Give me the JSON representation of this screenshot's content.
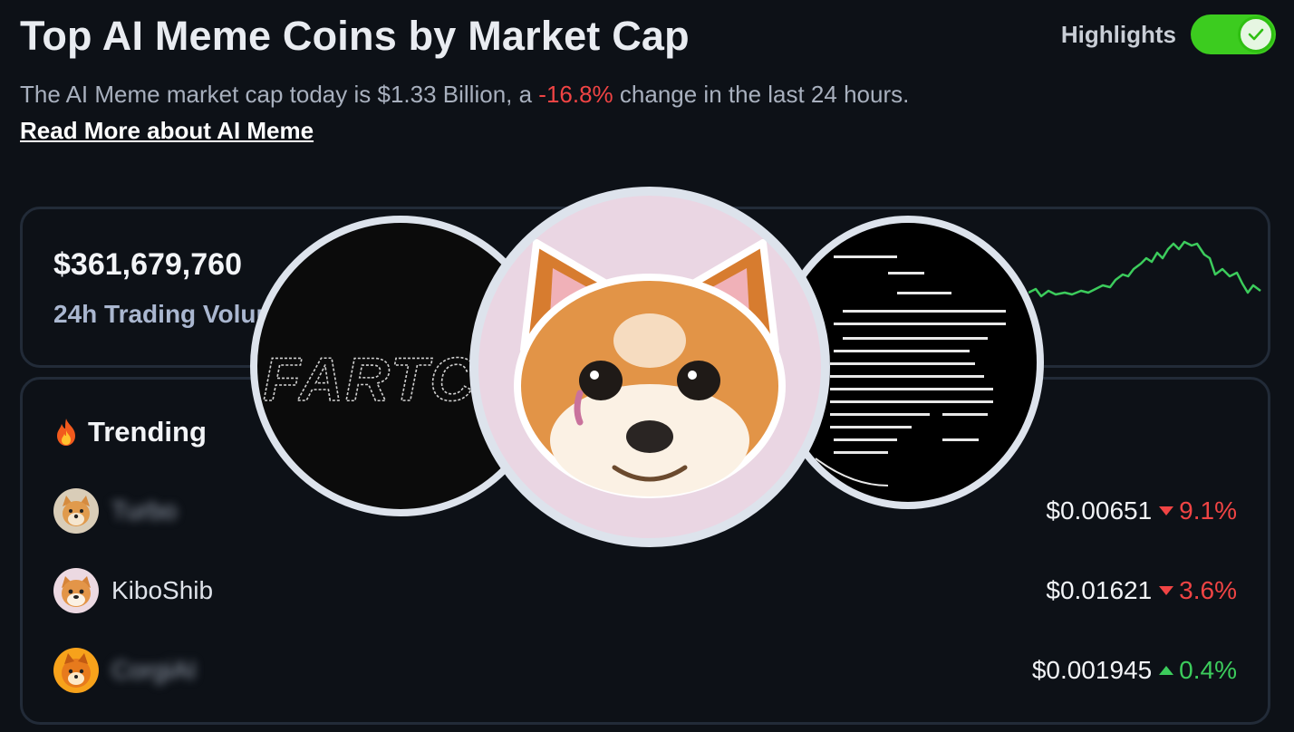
{
  "header": {
    "title": "Top AI Meme Coins by Market Cap",
    "subtitle_prefix": "The AI Meme market cap today is $1.33 Billion, a ",
    "subtitle_change": "-16.8%",
    "subtitle_suffix": " change in the last 24 hours. ",
    "read_more_link": "Read More about AI Meme",
    "highlights_label": "Highlights",
    "highlights_enabled": true
  },
  "volume_card": {
    "value": "$361,679,760",
    "label": "24h Trading Volume"
  },
  "overlay": {
    "left_logo_text": "FARTCOIN"
  },
  "trending": {
    "title": "Trending",
    "icon": "fire-icon",
    "items": [
      {
        "name": "Turbo",
        "name_blurred": true,
        "price": "$0.00651",
        "change": "9.1%",
        "direction": "down",
        "avatar_icon": "shiba-dog-icon"
      },
      {
        "name": "KiboShib",
        "name_blurred": false,
        "price": "$0.01621",
        "change": "3.6%",
        "direction": "down",
        "avatar_icon": "shiba-face-icon"
      },
      {
        "name": "CorgiAI",
        "name_blurred": true,
        "price": "$0.001945",
        "change": "0.4%",
        "direction": "up",
        "avatar_icon": "corgi-icon"
      }
    ]
  },
  "colors": {
    "negative": "#f04444",
    "positive": "#3ccc5c",
    "toggle_on": "#3ccc1f",
    "background": "#0d1117"
  }
}
